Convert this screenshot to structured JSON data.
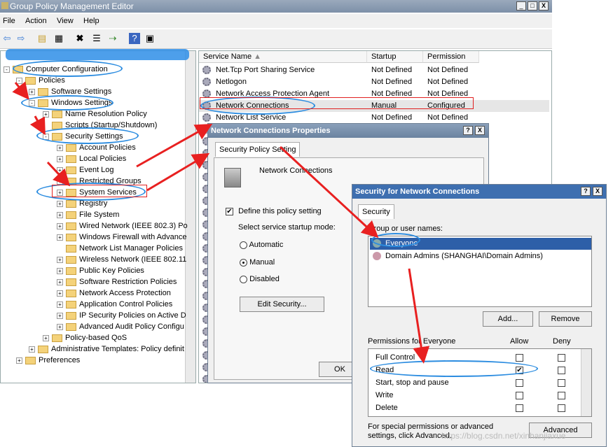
{
  "window": {
    "title": "Group Policy Management Editor",
    "buttons": [
      "_",
      "□",
      "X"
    ]
  },
  "menu": [
    "File",
    "Action",
    "View",
    "Help"
  ],
  "toolbar_icons": [
    "back-icon",
    "forward-icon",
    "up-folder-icon",
    "show-hide-tree-icon",
    "delete-icon",
    "properties-icon",
    "export-icon",
    "help-icon",
    "view-icon"
  ],
  "tree": [
    {
      "label": "Computer Configuration",
      "level": 0,
      "exp": "-"
    },
    {
      "label": "Policies",
      "level": 1,
      "exp": "-"
    },
    {
      "label": "Software Settings",
      "level": 2,
      "exp": "+"
    },
    {
      "label": "Windows Settings",
      "level": 2,
      "exp": "-"
    },
    {
      "label": "Name Resolution Policy",
      "level": 3,
      "exp": "+"
    },
    {
      "label": "Scripts (Startup/Shutdown)",
      "level": 3,
      "exp": ""
    },
    {
      "label": "Security Settings",
      "level": 3,
      "exp": "-"
    },
    {
      "label": "Account Policies",
      "level": 4,
      "exp": "+"
    },
    {
      "label": "Local Policies",
      "level": 4,
      "exp": "+"
    },
    {
      "label": "Event Log",
      "level": 4,
      "exp": "+"
    },
    {
      "label": "Restricted Groups",
      "level": 4,
      "exp": "+"
    },
    {
      "label": "System Services",
      "level": 4,
      "exp": "+"
    },
    {
      "label": "Registry",
      "level": 4,
      "exp": "+"
    },
    {
      "label": "File System",
      "level": 4,
      "exp": "+"
    },
    {
      "label": "Wired Network (IEEE 802.3) Po",
      "level": 4,
      "exp": "+"
    },
    {
      "label": "Windows Firewall with Advance",
      "level": 4,
      "exp": "+"
    },
    {
      "label": "Network List Manager Policies",
      "level": 4,
      "exp": ""
    },
    {
      "label": "Wireless Network (IEEE 802.11",
      "level": 4,
      "exp": "+"
    },
    {
      "label": "Public Key Policies",
      "level": 4,
      "exp": "+"
    },
    {
      "label": "Software Restriction Policies",
      "level": 4,
      "exp": "+"
    },
    {
      "label": "Network Access Protection",
      "level": 4,
      "exp": "+"
    },
    {
      "label": "Application Control Policies",
      "level": 4,
      "exp": "+"
    },
    {
      "label": "IP Security Policies on Active D",
      "level": 4,
      "exp": "+"
    },
    {
      "label": "Advanced Audit Policy Configu",
      "level": 4,
      "exp": "+"
    },
    {
      "label": "Policy-based QoS",
      "level": 3,
      "exp": "+"
    },
    {
      "label": "Administrative Templates: Policy definit",
      "level": 2,
      "exp": "+"
    },
    {
      "label": "Preferences",
      "level": 1,
      "exp": "+"
    }
  ],
  "list": {
    "headers": [
      "Service Name",
      "Startup",
      "Permission"
    ],
    "rows": [
      [
        "Net.Tcp Port Sharing Service",
        "Not Defined",
        "Not Defined"
      ],
      [
        "Netlogon",
        "Not Defined",
        "Not Defined"
      ],
      [
        "Network Access Protection Agent",
        "Not Defined",
        "Not Defined"
      ],
      [
        "Network Connections",
        "Manual",
        "Configured"
      ],
      [
        "Network List Service",
        "Not Defined",
        "Not Defined"
      ]
    ]
  },
  "props_dialog": {
    "title": "Network Connections Properties",
    "tab": "Security Policy Setting",
    "service_name": "Network Connections",
    "define_label": "Define this policy setting",
    "define_checked": true,
    "startup_label": "Select service startup mode:",
    "modes": [
      "Automatic",
      "Manual",
      "Disabled"
    ],
    "selected_mode": "Manual",
    "edit_button": "Edit Security...",
    "ok_button": "OK"
  },
  "sec_dialog": {
    "title": "Security for Network Connections",
    "tab": "Security",
    "group_label": "Group or user names:",
    "users": [
      "Everyone",
      "Domain Admins (SHANGHAI\\Domain Admins)"
    ],
    "add_button": "Add...",
    "remove_button": "Remove",
    "perm_label": "Permissions for Everyone",
    "allow_label": "Allow",
    "deny_label": "Deny",
    "permissions": [
      {
        "name": "Full Control",
        "allow": false,
        "deny": false
      },
      {
        "name": "Read",
        "allow": true,
        "deny": false
      },
      {
        "name": "Start, stop and pause",
        "allow": false,
        "deny": false
      },
      {
        "name": "Write",
        "allow": false,
        "deny": false
      },
      {
        "name": "Delete",
        "allow": false,
        "deny": false
      }
    ],
    "special_text": "For special permissions or advanced settings, click Advanced.",
    "advanced_button": "Advanced"
  },
  "watermark": "https://blog.csdn.net/xinhanjiaxue"
}
